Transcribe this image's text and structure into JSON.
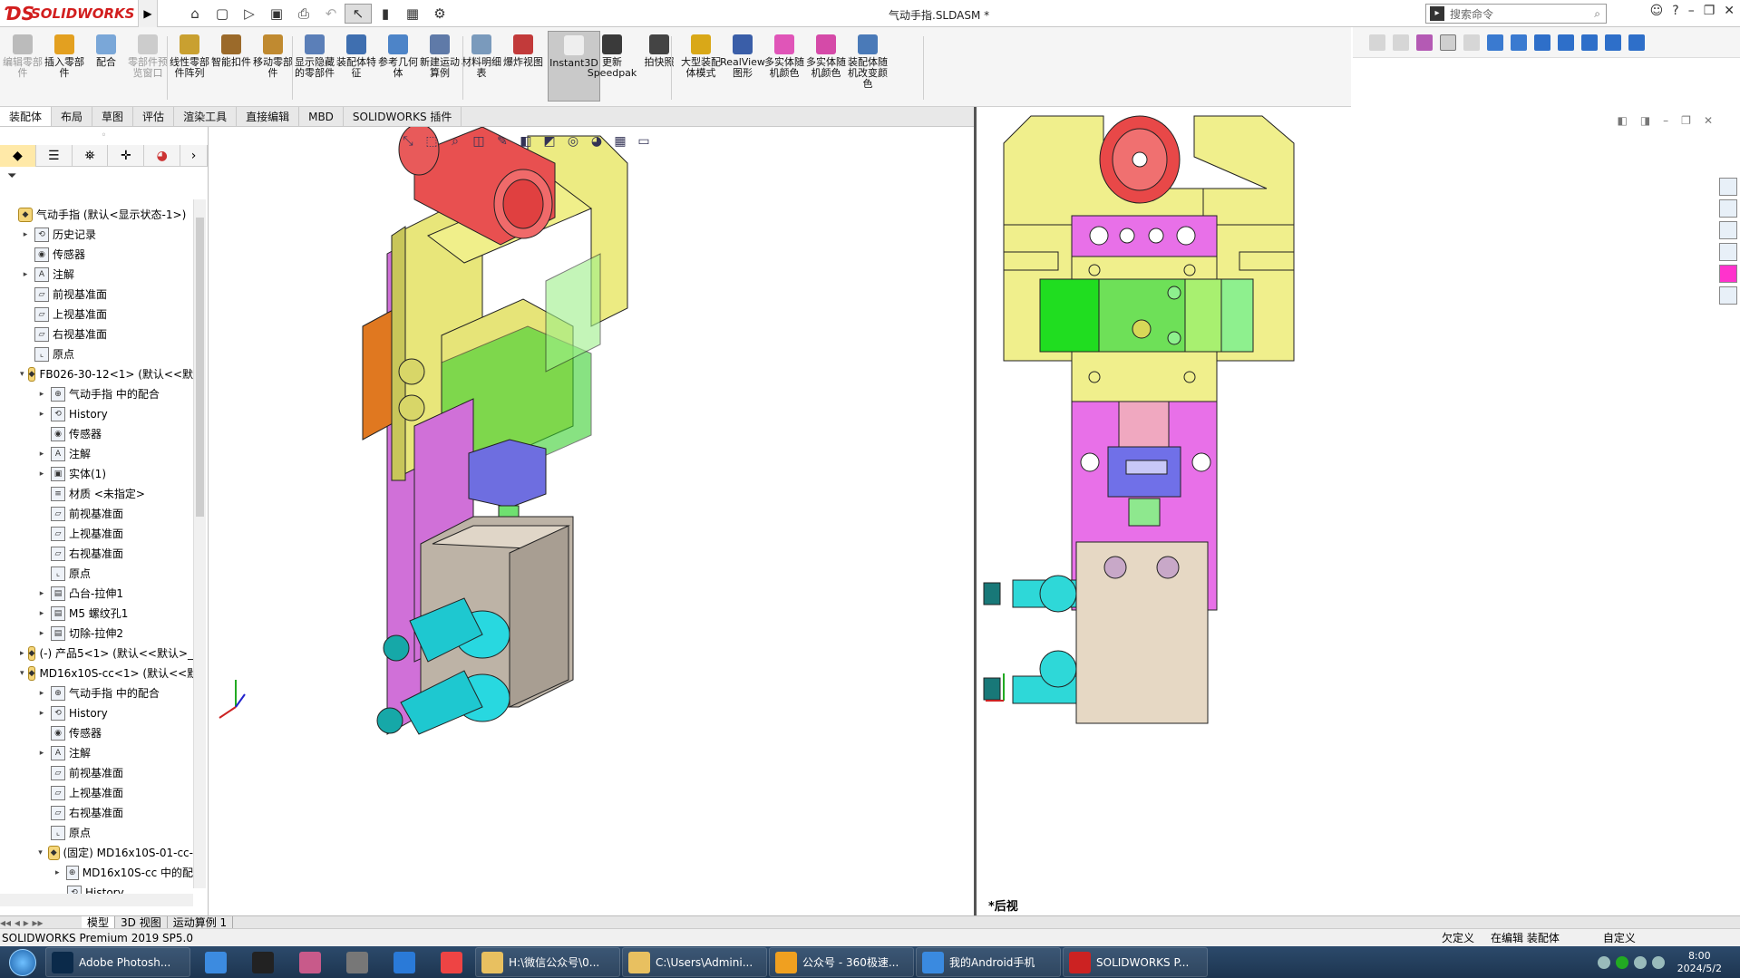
{
  "app": {
    "logo_text": "SOLIDWORKS",
    "title": "气动手指.SLDASM *"
  },
  "search": {
    "placeholder": "搜索命令"
  },
  "ribbon": {
    "buttons": [
      {
        "label": "编辑零部件",
        "disabled": true
      },
      {
        "label": "插入零部件"
      },
      {
        "label": "配合"
      },
      {
        "label": "零部件预览窗口",
        "disabled": true
      },
      {
        "label": "线性零部件阵列"
      },
      {
        "label": "智能扣件"
      },
      {
        "label": "移动零部件"
      },
      {
        "label": "显示隐藏的零部件"
      },
      {
        "label": "装配体特征"
      },
      {
        "label": "参考几何体"
      },
      {
        "label": "新建运动算例"
      },
      {
        "label": "材料明细表"
      },
      {
        "label": "爆炸视图"
      },
      {
        "label": "Instant3D",
        "active": true
      },
      {
        "label": "更新Speedpak"
      },
      {
        "label": "拍快照"
      },
      {
        "label": "大型装配体模式"
      },
      {
        "label": "RealView图形"
      },
      {
        "label": "多实体随机颜色"
      },
      {
        "label": "多实体随机颜色"
      },
      {
        "label": "装配体随机改变颜色"
      }
    ]
  },
  "tabs": [
    "装配体",
    "布局",
    "草图",
    "评估",
    "渲染工具",
    "直接编辑",
    "MBD",
    "SOLIDWORKS 插件"
  ],
  "tree": [
    {
      "indent": 0,
      "exp": "",
      "icon": "asm",
      "label": "气动手指  (默认<显示状态-1>)"
    },
    {
      "indent": 1,
      "exp": "▸",
      "icon": "hist",
      "label": "历史记录"
    },
    {
      "indent": 1,
      "exp": "",
      "icon": "sens",
      "label": "传感器"
    },
    {
      "indent": 1,
      "exp": "▸",
      "icon": "A",
      "label": "注解"
    },
    {
      "indent": 1,
      "exp": "",
      "icon": "plane",
      "label": "前视基准面"
    },
    {
      "indent": 1,
      "exp": "",
      "icon": "plane",
      "label": "上视基准面"
    },
    {
      "indent": 1,
      "exp": "",
      "icon": "plane",
      "label": "右视基准面"
    },
    {
      "indent": 1,
      "exp": "",
      "icon": "origin",
      "label": "原点"
    },
    {
      "indent": 1,
      "exp": "▾",
      "icon": "asm",
      "label": "FB026-30-12<1> (默认<<默"
    },
    {
      "indent": 2,
      "exp": "▸",
      "icon": "mate",
      "label": "气动手指 中的配合"
    },
    {
      "indent": 2,
      "exp": "▸",
      "icon": "hist",
      "label": "History"
    },
    {
      "indent": 2,
      "exp": "",
      "icon": "sens",
      "label": "传感器"
    },
    {
      "indent": 2,
      "exp": "▸",
      "icon": "A",
      "label": "注解"
    },
    {
      "indent": 2,
      "exp": "▸",
      "icon": "body",
      "label": "实体(1)"
    },
    {
      "indent": 2,
      "exp": "",
      "icon": "mat",
      "label": "材质 <未指定>"
    },
    {
      "indent": 2,
      "exp": "",
      "icon": "plane",
      "label": "前视基准面"
    },
    {
      "indent": 2,
      "exp": "",
      "icon": "plane",
      "label": "上视基准面"
    },
    {
      "indent": 2,
      "exp": "",
      "icon": "plane",
      "label": "右视基准面"
    },
    {
      "indent": 2,
      "exp": "",
      "icon": "origin",
      "label": "原点"
    },
    {
      "indent": 2,
      "exp": "▸",
      "icon": "feat",
      "label": "凸台-拉伸1"
    },
    {
      "indent": 2,
      "exp": "▸",
      "icon": "feat",
      "label": "M5 螺纹孔1"
    },
    {
      "indent": 2,
      "exp": "▸",
      "icon": "feat",
      "label": "切除-拉伸2"
    },
    {
      "indent": 1,
      "exp": "▸",
      "icon": "asm",
      "label": "(-) 产品5<1> (默认<<默认>_"
    },
    {
      "indent": 1,
      "exp": "▾",
      "icon": "asm",
      "label": "MD16x10S-cc<1> (默认<<默认"
    },
    {
      "indent": 2,
      "exp": "▸",
      "icon": "mate",
      "label": "气动手指 中的配合"
    },
    {
      "indent": 2,
      "exp": "▸",
      "icon": "hist",
      "label": "History"
    },
    {
      "indent": 2,
      "exp": "",
      "icon": "sens",
      "label": "传感器"
    },
    {
      "indent": 2,
      "exp": "▸",
      "icon": "A",
      "label": "注解"
    },
    {
      "indent": 2,
      "exp": "",
      "icon": "plane",
      "label": "前视基准面"
    },
    {
      "indent": 2,
      "exp": "",
      "icon": "plane",
      "label": "上视基准面"
    },
    {
      "indent": 2,
      "exp": "",
      "icon": "plane",
      "label": "右视基准面"
    },
    {
      "indent": 2,
      "exp": "",
      "icon": "origin",
      "label": "原点"
    },
    {
      "indent": 2,
      "exp": "▾",
      "icon": "asm",
      "label": "(固定) MD16x10S-01-cc-"
    },
    {
      "indent": 3,
      "exp": "▸",
      "icon": "mate",
      "label": "MD16x10S-cc 中的配"
    },
    {
      "indent": 3,
      "exp": "",
      "icon": "hist",
      "label": "History"
    }
  ],
  "viewports": {
    "right_label": "*后视"
  },
  "bottom_tabs": [
    "模型",
    "3D 视图",
    "运动算例 1"
  ],
  "status": {
    "version": "SOLIDWORKS Premium 2019 SP5.0",
    "defined": "欠定义",
    "editing": "在编辑 装配体",
    "custom": "自定义"
  },
  "taskbar": {
    "items": [
      {
        "label": "Adobe Photosh...",
        "color": "#0b2a4a"
      },
      {
        "label": "",
        "color": "#3c8be0"
      },
      {
        "label": "",
        "color": "#222"
      },
      {
        "label": "",
        "color": "#c85a8a"
      },
      {
        "label": "",
        "color": "#777"
      },
      {
        "label": "",
        "color": "#2a7ad8"
      },
      {
        "label": "",
        "color": "#e44"
      },
      {
        "label": "H:\\微信公众号\\0...",
        "color": "#e8c060"
      },
      {
        "label": "C:\\Users\\Admini...",
        "color": "#e8c060"
      },
      {
        "label": "公众号 - 360极速...",
        "color": "#f0a020"
      },
      {
        "label": "我的Android手机",
        "color": "#3a8ae0"
      },
      {
        "label": "SOLIDWORKS P...",
        "color": "#c22"
      }
    ],
    "time": "8:00",
    "date": "2024/5/2"
  }
}
